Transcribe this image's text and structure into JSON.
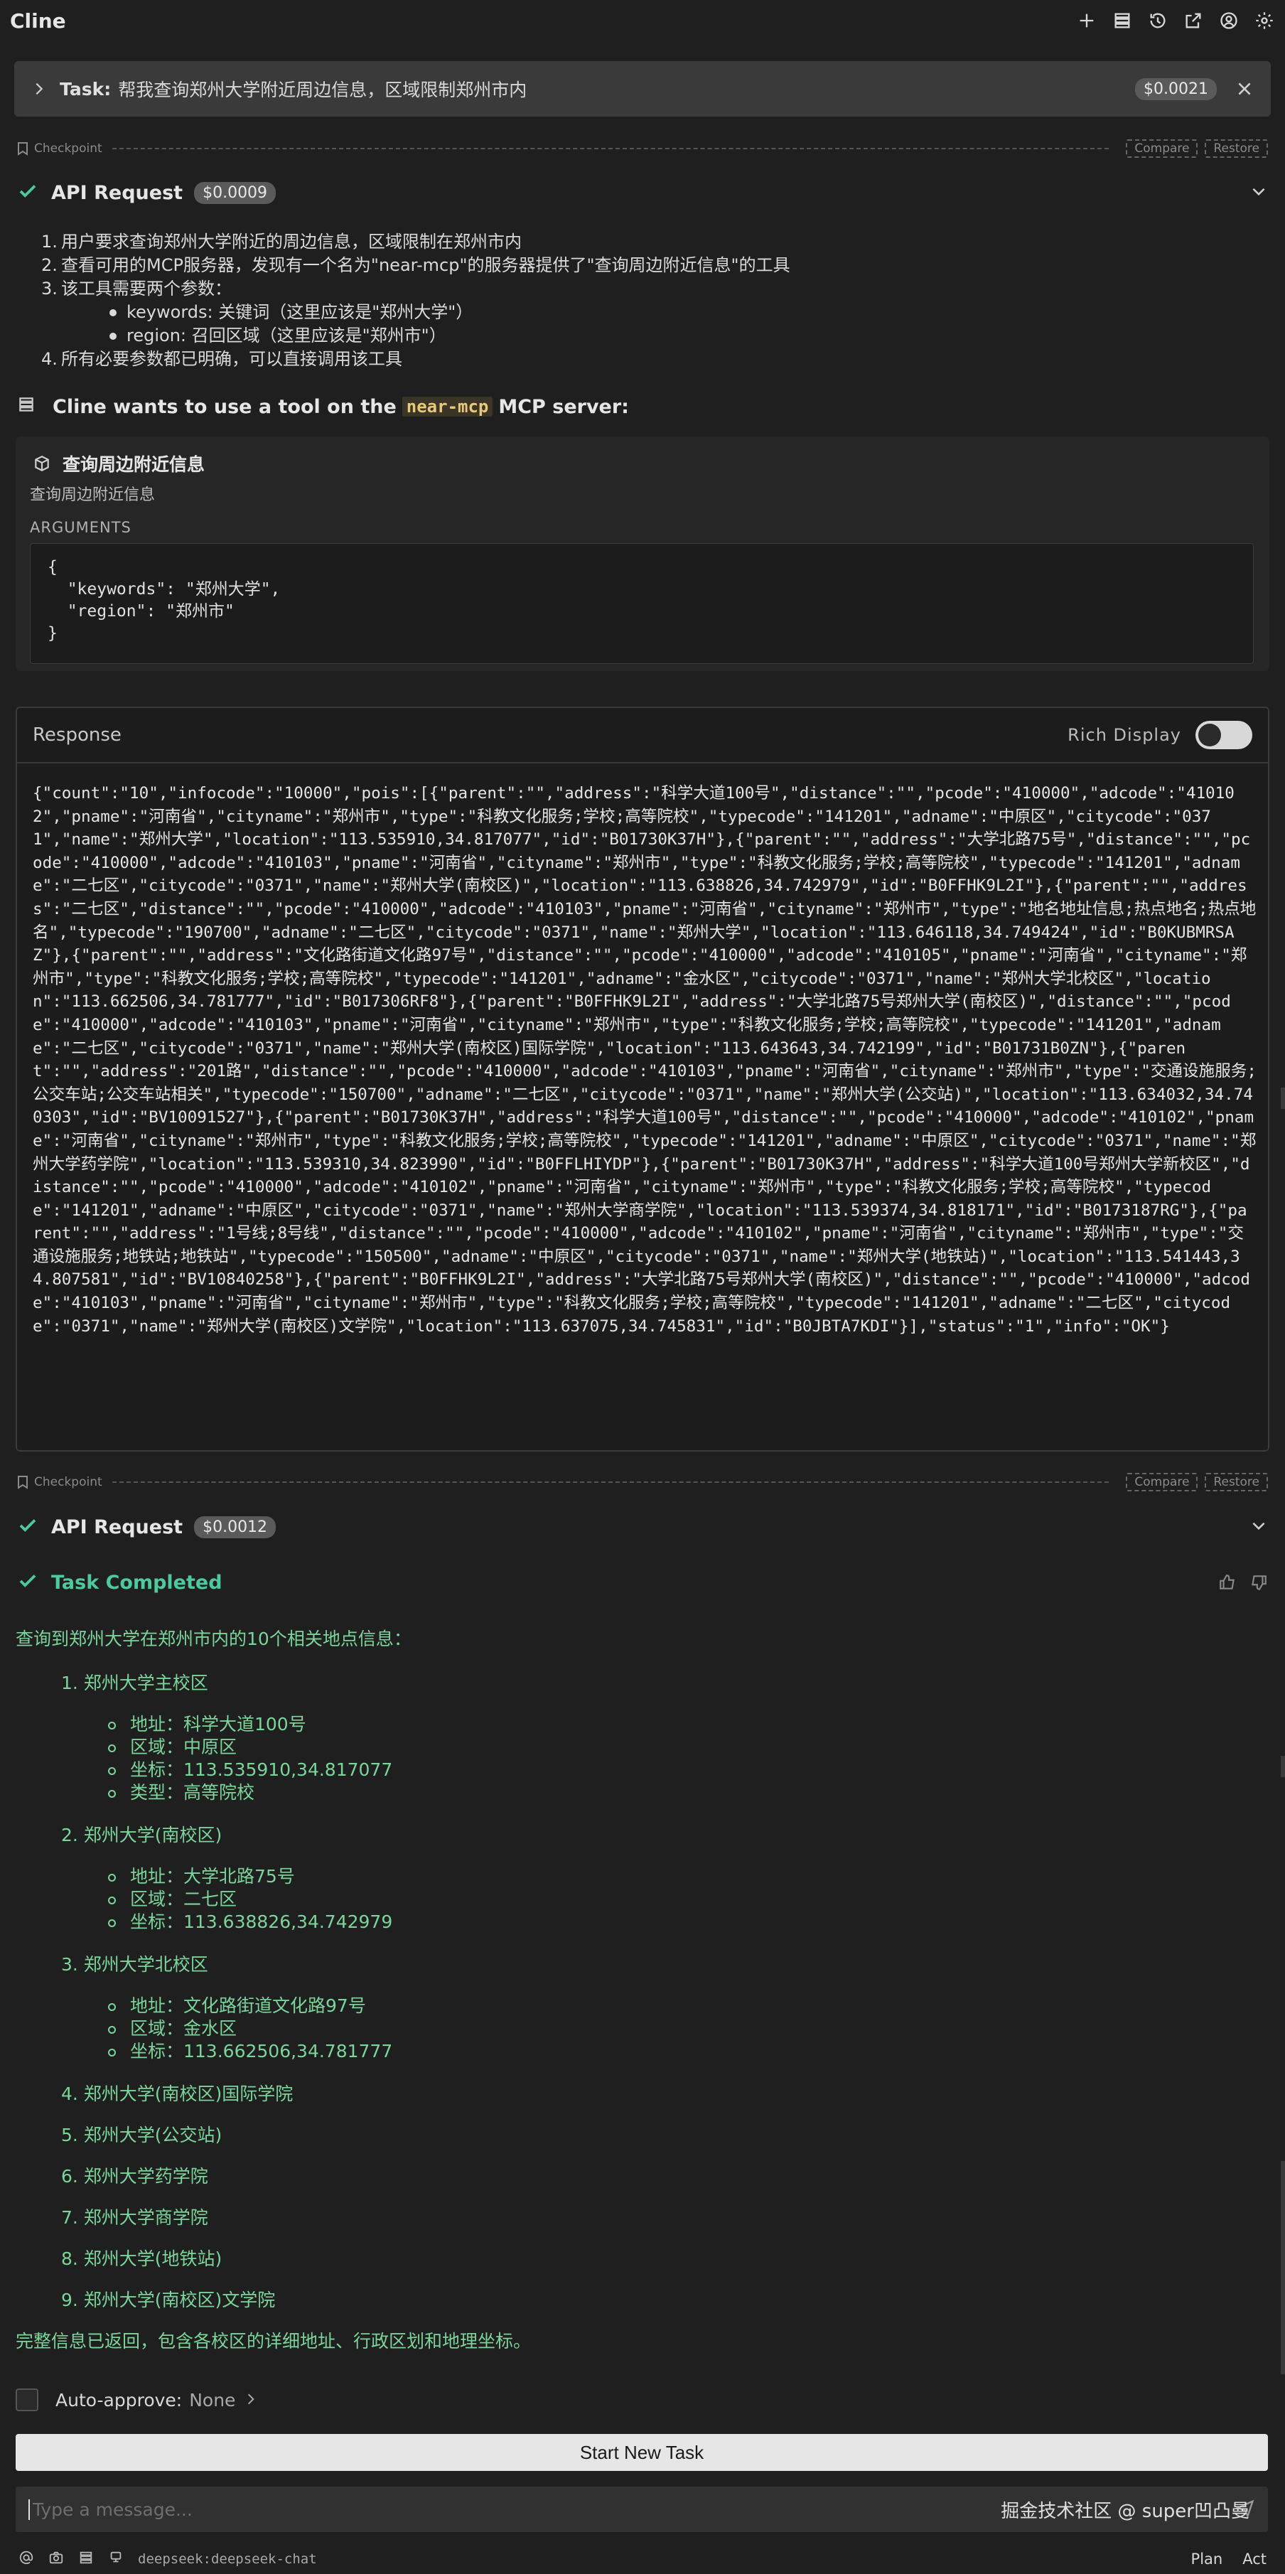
{
  "app": {
    "title": "Cline"
  },
  "task": {
    "label": "Task:",
    "text": "帮我查询郑州大学附近周边信息，区域限制郑州市内",
    "cost": "$0.0021"
  },
  "checkpoint": {
    "label": "Checkpoint",
    "compare": "Compare",
    "restore": "Restore"
  },
  "api_request_1": {
    "label": "API Request",
    "cost": "$0.0009"
  },
  "reasoning": {
    "items": [
      "用户要求查询郑州大学附近的周边信息，区域限制在郑州市内",
      "查看可用的MCP服务器，发现有一个名为\"near-mcp\"的服务器提供了\"查询周边附近信息\"的工具",
      "该工具需要两个参数：",
      "所有必要参数都已明确，可以直接调用该工具"
    ],
    "params": [
      "keywords: 关键词（这里应该是\"郑州大学\"）",
      "region: 召回区域（这里应该是\"郑州市\"）"
    ]
  },
  "tool_use": {
    "prefix": "Cline wants to use a tool on the",
    "server": "near-mcp",
    "suffix": "MCP server:",
    "tool_name": "查询周边附近信息",
    "tool_desc": "查询周边附近信息",
    "args_label": "ARGUMENTS",
    "args": "{\n  \"keywords\": \"郑州大学\",\n  \"region\": \"郑州市\"\n}"
  },
  "response": {
    "title": "Response",
    "rich_display": "Rich Display",
    "body": "{\"count\":\"10\",\"infocode\":\"10000\",\"pois\":[{\"parent\":\"\",\"address\":\"科学大道100号\",\"distance\":\"\",\"pcode\":\"410000\",\"adcode\":\"410102\",\"pname\":\"河南省\",\"cityname\":\"郑州市\",\"type\":\"科教文化服务;学校;高等院校\",\"typecode\":\"141201\",\"adname\":\"中原区\",\"citycode\":\"0371\",\"name\":\"郑州大学\",\"location\":\"113.535910,34.817077\",\"id\":\"B01730K37H\"},{\"parent\":\"\",\"address\":\"大学北路75号\",\"distance\":\"\",\"pcode\":\"410000\",\"adcode\":\"410103\",\"pname\":\"河南省\",\"cityname\":\"郑州市\",\"type\":\"科教文化服务;学校;高等院校\",\"typecode\":\"141201\",\"adname\":\"二七区\",\"citycode\":\"0371\",\"name\":\"郑州大学(南校区)\",\"location\":\"113.638826,34.742979\",\"id\":\"B0FFHK9L2I\"},{\"parent\":\"\",\"address\":\"二七区\",\"distance\":\"\",\"pcode\":\"410000\",\"adcode\":\"410103\",\"pname\":\"河南省\",\"cityname\":\"郑州市\",\"type\":\"地名地址信息;热点地名;热点地名\",\"typecode\":\"190700\",\"adname\":\"二七区\",\"citycode\":\"0371\",\"name\":\"郑州大学\",\"location\":\"113.646118,34.749424\",\"id\":\"B0KUBMRSAZ\"},{\"parent\":\"\",\"address\":\"文化路街道文化路97号\",\"distance\":\"\",\"pcode\":\"410000\",\"adcode\":\"410105\",\"pname\":\"河南省\",\"cityname\":\"郑州市\",\"type\":\"科教文化服务;学校;高等院校\",\"typecode\":\"141201\",\"adname\":\"金水区\",\"citycode\":\"0371\",\"name\":\"郑州大学北校区\",\"location\":\"113.662506,34.781777\",\"id\":\"B017306RF8\"},{\"parent\":\"B0FFHK9L2I\",\"address\":\"大学北路75号郑州大学(南校区)\",\"distance\":\"\",\"pcode\":\"410000\",\"adcode\":\"410103\",\"pname\":\"河南省\",\"cityname\":\"郑州市\",\"type\":\"科教文化服务;学校;高等院校\",\"typecode\":\"141201\",\"adname\":\"二七区\",\"citycode\":\"0371\",\"name\":\"郑州大学(南校区)国际学院\",\"location\":\"113.643643,34.742199\",\"id\":\"B01731B0ZN\"},{\"parent\":\"\",\"address\":\"201路\",\"distance\":\"\",\"pcode\":\"410000\",\"adcode\":\"410103\",\"pname\":\"河南省\",\"cityname\":\"郑州市\",\"type\":\"交通设施服务;公交车站;公交车站相关\",\"typecode\":\"150700\",\"adname\":\"二七区\",\"citycode\":\"0371\",\"name\":\"郑州大学(公交站)\",\"location\":\"113.634032,34.740303\",\"id\":\"BV10091527\"},{\"parent\":\"B01730K37H\",\"address\":\"科学大道100号\",\"distance\":\"\",\"pcode\":\"410000\",\"adcode\":\"410102\",\"pname\":\"河南省\",\"cityname\":\"郑州市\",\"type\":\"科教文化服务;学校;高等院校\",\"typecode\":\"141201\",\"adname\":\"中原区\",\"citycode\":\"0371\",\"name\":\"郑州大学药学院\",\"location\":\"113.539310,34.823990\",\"id\":\"B0FFLHIYDP\"},{\"parent\":\"B01730K37H\",\"address\":\"科学大道100号郑州大学新校区\",\"distance\":\"\",\"pcode\":\"410000\",\"adcode\":\"410102\",\"pname\":\"河南省\",\"cityname\":\"郑州市\",\"type\":\"科教文化服务;学校;高等院校\",\"typecode\":\"141201\",\"adname\":\"中原区\",\"citycode\":\"0371\",\"name\":\"郑州大学商学院\",\"location\":\"113.539374,34.818171\",\"id\":\"B0173187RG\"},{\"parent\":\"\",\"address\":\"1号线;8号线\",\"distance\":\"\",\"pcode\":\"410000\",\"adcode\":\"410102\",\"pname\":\"河南省\",\"cityname\":\"郑州市\",\"type\":\"交通设施服务;地铁站;地铁站\",\"typecode\":\"150500\",\"adname\":\"中原区\",\"citycode\":\"0371\",\"name\":\"郑州大学(地铁站)\",\"location\":\"113.541443,34.807581\",\"id\":\"BV10840258\"},{\"parent\":\"B0FFHK9L2I\",\"address\":\"大学北路75号郑州大学(南校区)\",\"distance\":\"\",\"pcode\":\"410000\",\"adcode\":\"410103\",\"pname\":\"河南省\",\"cityname\":\"郑州市\",\"type\":\"科教文化服务;学校;高等院校\",\"typecode\":\"141201\",\"adname\":\"二七区\",\"citycode\":\"0371\",\"name\":\"郑州大学(南校区)文学院\",\"location\":\"113.637075,34.745831\",\"id\":\"B0JBTA7KDI\"}],\"status\":\"1\",\"info\":\"OK\"}"
  },
  "api_request_2": {
    "label": "API Request",
    "cost": "$0.0012"
  },
  "completed": {
    "label": "Task Completed",
    "intro": "查询到郑州大学在郑州市内的10个相关地点信息：",
    "items": [
      "1. 郑州大学主校区",
      "2. 郑州大学(南校区)",
      "3. 郑州大学北校区",
      "4. 郑州大学(南校区)国际学院",
      "5. 郑州大学(公交站)",
      "6. 郑州大学药学院",
      "7. 郑州大学商学院",
      "8. 郑州大学(地铁站)",
      "9. 郑州大学(南校区)文学院"
    ],
    "item1_details": [
      "地址：科学大道100号",
      "区域：中原区",
      "坐标：113.535910,34.817077",
      "类型：高等院校"
    ],
    "item2_details": [
      "地址：大学北路75号",
      "区域：二七区",
      "坐标：113.638826,34.742979"
    ],
    "item3_details": [
      "地址：文化路街道文化路97号",
      "区域：金水区",
      "坐标：113.662506,34.781777"
    ],
    "outro": "完整信息已返回，包含各校区的详细地址、行政区划和地理坐标。"
  },
  "footer": {
    "auto_approve_label": "Auto-approve:",
    "auto_approve_value": "None",
    "new_task": "Start New Task",
    "placeholder": "Type a message...",
    "watermark": "掘金技术社区 @ super凹凸曼",
    "model": "deepseek:deepseek-chat",
    "mode_plan": "Plan",
    "mode_act": "Act"
  },
  "colors": {
    "accent_green": "#4ec99b",
    "result_green": "#7bd59a",
    "server_badge": "#e8c979"
  }
}
